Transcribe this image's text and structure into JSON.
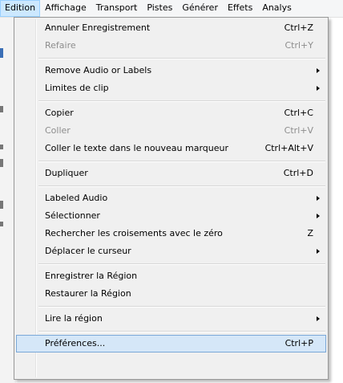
{
  "menubar": {
    "items": [
      "Edition",
      "Affichage",
      "Transport",
      "Pistes",
      "Générer",
      "Effets",
      "Analys"
    ]
  },
  "menu": {
    "items": [
      {
        "label": "Annuler Enregistrement",
        "shortcut": "Ctrl+Z"
      },
      {
        "label": "Refaire",
        "shortcut": "Ctrl+Y",
        "disabled": true
      },
      {
        "separator": true
      },
      {
        "label": "Remove Audio or Labels",
        "submenu": true
      },
      {
        "label": "Limites de clip",
        "submenu": true
      },
      {
        "separator": true
      },
      {
        "label": "Copier",
        "shortcut": "Ctrl+C"
      },
      {
        "label": "Coller",
        "shortcut": "Ctrl+V",
        "disabled": true
      },
      {
        "label": "Coller le texte dans le nouveau marqueur",
        "shortcut": "Ctrl+Alt+V"
      },
      {
        "separator": true
      },
      {
        "label": "Dupliquer",
        "shortcut": "Ctrl+D"
      },
      {
        "separator": true
      },
      {
        "label": "Labeled Audio",
        "submenu": true
      },
      {
        "label": "Sélectionner",
        "submenu": true
      },
      {
        "label": "Rechercher les croisements avec le zéro",
        "shortcut": "Z"
      },
      {
        "label": "Déplacer le curseur",
        "submenu": true
      },
      {
        "separator": true
      },
      {
        "label": "Enregistrer la Région"
      },
      {
        "label": "Restaurer la Région"
      },
      {
        "separator": true
      },
      {
        "label": "Lire la région",
        "submenu": true
      },
      {
        "separator": true
      },
      {
        "label": "Préférences...",
        "shortcut": "Ctrl+P",
        "hover": true
      }
    ]
  }
}
